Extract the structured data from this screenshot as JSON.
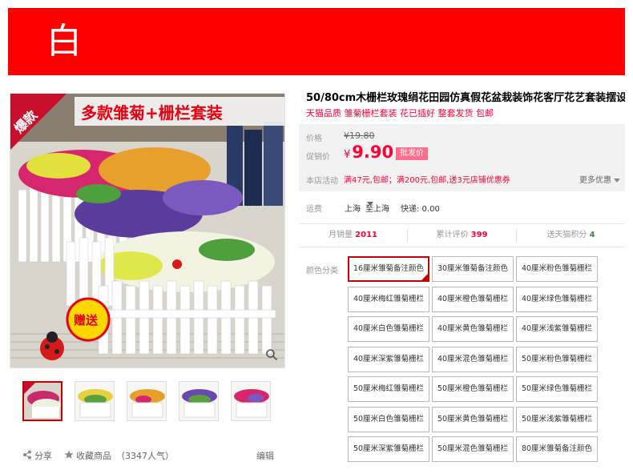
{
  "banner": {
    "text": "白",
    "color": "#ff0000"
  },
  "product": {
    "title": "50/80cm木栅栏玫瑰绢花田园仿真假花盆栽装饰花客厅花艺套装摆设",
    "subtitle": "天猫品质 雏菊栅栏套装 花已插好 整套发货 包邮",
    "image_text": {
      "top": "多款雏菊+栅栏套装",
      "badge": "爆款",
      "gift": "赠送"
    }
  },
  "price": {
    "label": "价格",
    "original": "¥19.80",
    "promo_label": "促销价",
    "currency": "¥",
    "promo_value": "9.90",
    "promo_tag": "批发价",
    "store_label": "本店活动",
    "store_promo": "满47元,包邮；满200元,包邮,送3元店铺优惠券",
    "more": "更多优惠"
  },
  "shipping": {
    "label": "运费",
    "from": "上海",
    "to": "至上海",
    "method": "快递: 0.00"
  },
  "stats": {
    "monthly_sales_label": "月销量",
    "monthly_sales": "2011",
    "reviews_label": "累计评价",
    "reviews": "399",
    "points_label": "送天猫积分",
    "points": "4"
  },
  "color_category": {
    "label": "颜色分类",
    "selected_index": 0,
    "options": [
      "16厘米雏菊备注颜色",
      "30厘米雏菊备注颜色",
      "40厘米粉色雏菊栅栏",
      "40厘米梅红雏菊栅栏",
      "40厘米橙色雏菊栅栏",
      "40厘米绿色雏菊栅栏",
      "40厘米白色雏菊栅栏",
      "40厘米黄色雏菊栅栏",
      "40厘米浅紫雏菊栅栏",
      "40厘米深紫雏菊栅栏",
      "40厘米混色雏菊栅栏",
      "50厘米粉色雏菊栅栏",
      "50厘米梅红雏菊栅栏",
      "50厘米橙色雏菊栅栏",
      "50厘米绿色雏菊栅栏",
      "50厘米白色雏菊栅栏",
      "50厘米黄色雏菊栅栏",
      "50厘米浅紫雏菊栅栏",
      "50厘米深紫雏菊栅栏",
      "50厘米混色雏菊栅栏",
      "80厘米雏菊备注颜色"
    ]
  },
  "actions": {
    "share": "分享",
    "favorite": "收藏商品",
    "favorite_count": "（3347人气）",
    "edit": "编辑"
  },
  "colors": {
    "accent": "#ff0036",
    "selected_border": "#c40000",
    "tag": "#ff6f8d"
  }
}
